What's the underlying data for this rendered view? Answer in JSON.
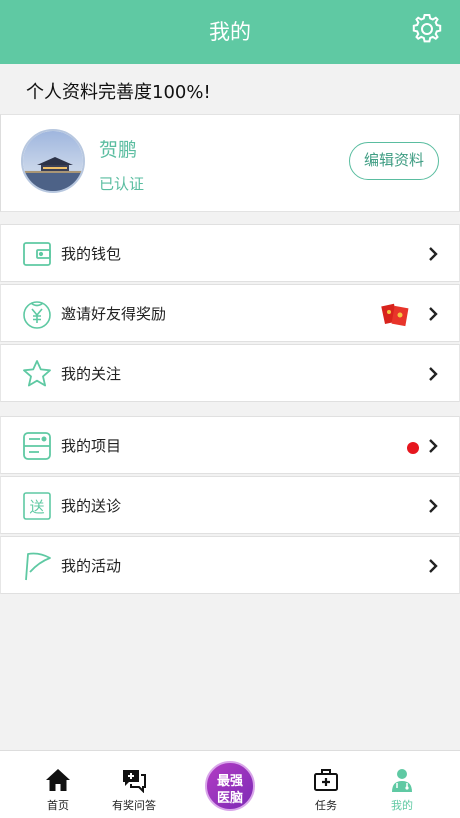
{
  "header": {
    "title": "我的"
  },
  "completion": {
    "text": "个人资料完善度100%!"
  },
  "profile": {
    "name": "贺鹏",
    "status": "已认证",
    "edit_label": "编辑资料"
  },
  "menu": {
    "group1": [
      {
        "label": "我的钱包",
        "icon": "wallet-icon"
      },
      {
        "label": "邀请好友得奖励",
        "icon": "yen-coin-icon"
      },
      {
        "label": "我的关注",
        "icon": "star-icon"
      }
    ],
    "group2": [
      {
        "label": "我的项目",
        "icon": "project-icon"
      },
      {
        "label": "我的送诊",
        "icon": "referral-icon",
        "icon_text": "送"
      },
      {
        "label": "我的活动",
        "icon": "flag-icon"
      }
    ]
  },
  "tabbar": {
    "items": [
      {
        "label": "首页",
        "icon": "home-icon"
      },
      {
        "label": "有奖问答",
        "icon": "qa-icon"
      },
      {
        "label": "任务",
        "icon": "toolbox-icon"
      },
      {
        "label": "我的",
        "icon": "doctor-icon"
      }
    ],
    "center": {
      "line1": "最强",
      "line2": "医脑"
    }
  },
  "colors": {
    "primary": "#5fc9a3",
    "accent_text": "#5abda0",
    "badge_red": "#e6161e"
  }
}
